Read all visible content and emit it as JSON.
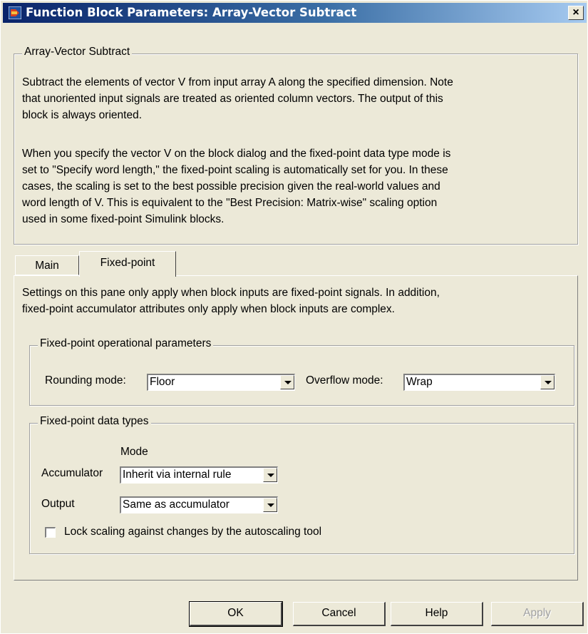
{
  "window": {
    "title": "Function Block Parameters: Array-Vector Subtract",
    "close_label": "×"
  },
  "description": {
    "group_title": "Array-Vector Subtract",
    "paragraph1_lines": [
      "Subtract the elements of vector V from input array A along the specified dimension. Note",
      "that unoriented input signals are treated as oriented column vectors. The output of this",
      "block is always oriented."
    ],
    "paragraph2_lines": [
      "When you specify the vector V on the block dialog and the fixed-point data type mode is",
      "set to \"Specify word length,\" the fixed-point scaling is automatically set for you. In these",
      "cases, the scaling is set to the best possible precision given the real-world values and",
      "word length of V. This is equivalent to the \"Best Precision: Matrix-wise\" scaling option",
      "used in some fixed-point Simulink blocks."
    ]
  },
  "tabs": [
    {
      "label": "Main",
      "active": false
    },
    {
      "label": "Fixed-point",
      "active": true
    }
  ],
  "fixed_point_pane": {
    "intro_lines": [
      "Settings on this pane only apply when block inputs are fixed-point signals. In addition,",
      "fixed-point accumulator attributes only apply when block inputs are complex."
    ],
    "operational": {
      "group_title": "Fixed-point operational parameters",
      "rounding_label": "Rounding mode:",
      "rounding_value": "Floor",
      "overflow_label": "Overflow mode:",
      "overflow_value": "Wrap"
    },
    "data_types": {
      "group_title": "Fixed-point data types",
      "mode_header": "Mode",
      "accumulator_label": "Accumulator",
      "accumulator_value": "Inherit via internal rule",
      "output_label": "Output",
      "output_value": "Same as accumulator",
      "lock_scaling_label": "Lock scaling against changes by the autoscaling tool",
      "lock_scaling_checked": false
    }
  },
  "buttons": {
    "ok": "OK",
    "cancel": "Cancel",
    "help": "Help",
    "apply": "Apply"
  }
}
